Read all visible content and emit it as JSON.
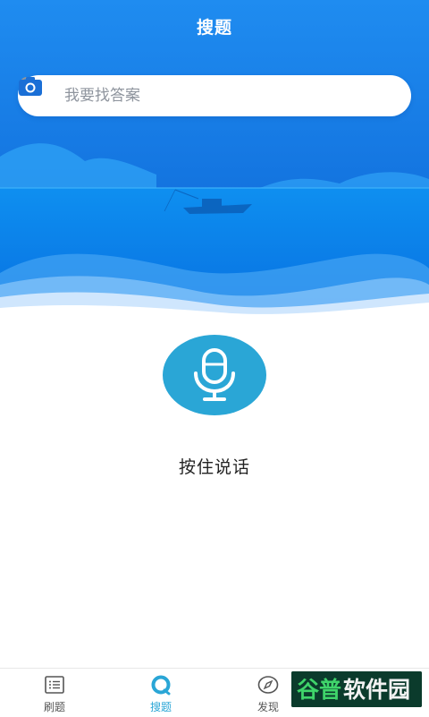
{
  "header": {
    "title": "搜题"
  },
  "search": {
    "placeholder": "我要找答案"
  },
  "voice": {
    "label": "按住说话"
  },
  "bottom_nav": {
    "items": [
      {
        "label": "刷题",
        "icon": "list-icon",
        "active": false
      },
      {
        "label": "搜题",
        "icon": "search-ring-icon",
        "active": true
      },
      {
        "label": "发现",
        "icon": "compass-icon",
        "active": false
      }
    ]
  },
  "watermark": {
    "text": "谷普软件园"
  },
  "colors": {
    "brand_blue": "#1a7fe8",
    "accent": "#2aa6d6",
    "text_dark": "#222222",
    "placeholder": "#8f959e"
  }
}
